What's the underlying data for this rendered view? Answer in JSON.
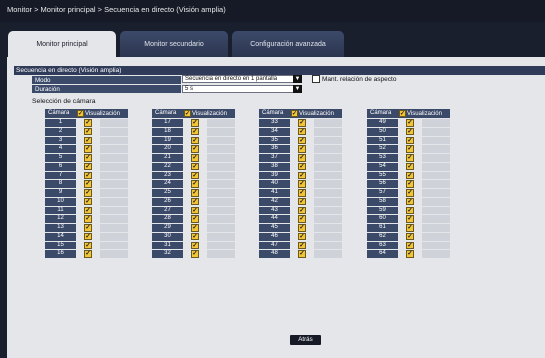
{
  "breadcrumb": "Monitor > Monitor principal > Secuencia en directo (Visión amplia)",
  "tabs": [
    {
      "label": "Monitor principal"
    },
    {
      "label": "Monitor secundario"
    },
    {
      "label": "Configuración avanzada"
    }
  ],
  "section_title": "Secuencia en directo (Visión amplia)",
  "settings": {
    "mode_label": "Modo",
    "mode_value": "Secuencia en directo en 1 pantalla",
    "duration_label": "Duración",
    "duration_value": "5 s",
    "aspect_label": "Mant. relación de aspecto"
  },
  "camera_selection_label": "Selección de cámara",
  "table_headers": {
    "camera": "Cámara",
    "display": "Visualización"
  },
  "camera_columns": [
    [
      "1",
      "2",
      "3",
      "4",
      "5",
      "6",
      "7",
      "8",
      "9",
      "10",
      "11",
      "12",
      "13",
      "14",
      "15",
      "16"
    ],
    [
      "17",
      "18",
      "19",
      "20",
      "21",
      "22",
      "23",
      "24",
      "25",
      "26",
      "27",
      "28",
      "29",
      "30",
      "31",
      "32"
    ],
    [
      "33",
      "34",
      "35",
      "36",
      "37",
      "38",
      "39",
      "40",
      "41",
      "42",
      "43",
      "44",
      "45",
      "46",
      "47",
      "48"
    ],
    [
      "49",
      "50",
      "51",
      "52",
      "53",
      "54",
      "55",
      "56",
      "57",
      "58",
      "59",
      "60",
      "61",
      "62",
      "63",
      "64"
    ]
  ],
  "checkmark": "✓",
  "back_button": "Atrás"
}
